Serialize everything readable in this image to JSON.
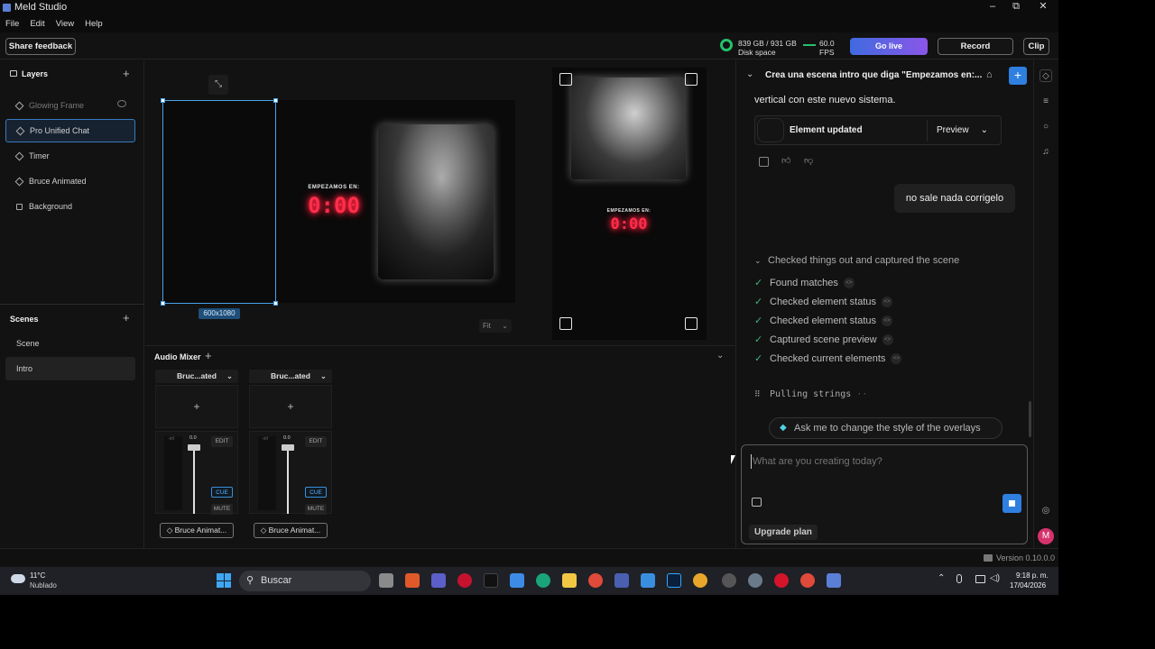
{
  "app": {
    "title": "Meld Studio"
  },
  "window_controls": {
    "minimize": "–",
    "maximize": "⧉",
    "close": "✕"
  },
  "menu": [
    "File",
    "Edit",
    "View",
    "Help"
  ],
  "toolbar": {
    "share_feedback": "Share feedback",
    "disk_usage": "839 GB / 931 GB",
    "disk_label": "Disk space",
    "fps_value": "60.0",
    "fps_label": "FPS",
    "go_live": "Go live",
    "record": "Record",
    "clip": "Clip"
  },
  "layers": {
    "title": "Layers",
    "items": [
      {
        "label": "Glowing Frame",
        "hidden": true
      },
      {
        "label": "Pro Unified Chat",
        "selected": true
      },
      {
        "label": "Timer"
      },
      {
        "label": "Bruce Animated"
      },
      {
        "label": "Background"
      }
    ]
  },
  "scenes": {
    "title": "Scenes",
    "items": [
      {
        "label": "Scene"
      },
      {
        "label": "Intro",
        "selected": true
      }
    ]
  },
  "canvas": {
    "selection_size": "600x1080",
    "fit_label": "Fit",
    "overlay_heading": "EMPEZAMOS EN:",
    "timer_value": "0:00"
  },
  "vertical_preview": {
    "overlay_heading": "EMPEZAMOS EN:",
    "timer_value": "0:00"
  },
  "audio_mixer": {
    "title": "Audio Mixer",
    "channels": [
      {
        "header": "Bruc...ated",
        "db_label": "-inf",
        "fader_value": "0.0",
        "edit": "EDIT",
        "cue": "CUE",
        "mute": "MUTE",
        "name": "Bruce Animat..."
      },
      {
        "header": "Bruc...ated",
        "db_label": "-inf",
        "fader_value": "0.0",
        "edit": "EDIT",
        "cue": "CUE",
        "mute": "MUTE",
        "name": "Bruce Animat..."
      }
    ]
  },
  "chat": {
    "header_title": "Crea una escena intro que diga \"Empezamos en:...",
    "message_tail": "vertical con este nuevo sistema.",
    "element_updated": "Element updated",
    "preview_button": "Preview",
    "user_message": "no sale nada corrigelo",
    "steps_summary": "Checked things out and captured the scene",
    "steps": [
      "Found matches",
      "Checked element status",
      "Checked element status",
      "Captured scene preview",
      "Checked current elements"
    ],
    "pulling": "Pulling strings",
    "pulling_suffix": "··",
    "suggestion": "Ask me to change the style of the overlays",
    "input_placeholder": "What are you creating today?",
    "upgrade": "Upgrade plan",
    "avatar_initial": "M"
  },
  "status_bar": {
    "version": "Version 0.10.0.0"
  },
  "taskbar": {
    "weather_temp": "11°C",
    "weather_desc": "Nublado",
    "search_placeholder": "Buscar",
    "time": "9:18 p. m.",
    "date": "17/04/2026"
  },
  "colors": {
    "accent_blue": "#2f7fe0",
    "go_live_start": "#3f6be0",
    "go_live_end": "#8a56e8",
    "timer_red": "#ff2d4a",
    "success_green": "#25c06b",
    "selection_blue": "#4aa3e8"
  }
}
